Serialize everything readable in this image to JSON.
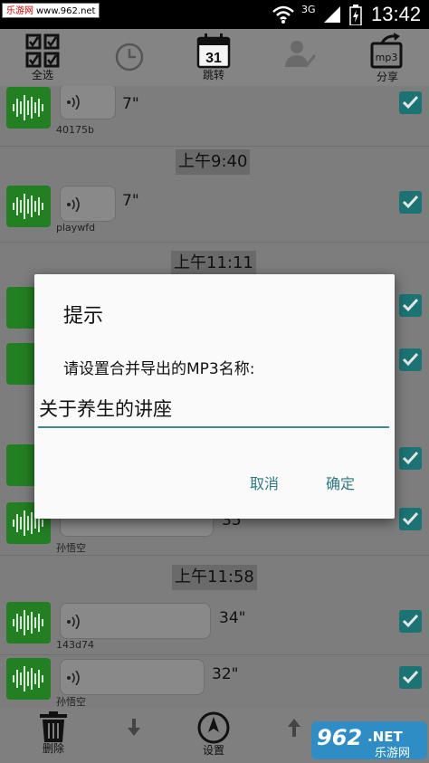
{
  "status_bar": {
    "watermark_site": "乐游网",
    "watermark_url": "www.962.net",
    "network": "3G",
    "time": "13:42",
    "icons": [
      "wifi-icon",
      "signal-icon",
      "battery-icon"
    ]
  },
  "toolbar": {
    "select_all_label": "全选",
    "jump_label": "跳转",
    "jump_day": "31",
    "share_label": "分享",
    "share_badge": "mp3"
  },
  "messages": [
    {
      "duration": "7\"",
      "name": "40175b"
    },
    {
      "duration": "7\"",
      "name": "playwfd"
    },
    {
      "duration": "35\"",
      "name": "孙悟空"
    },
    {
      "duration": "34\"",
      "name": "143d74"
    },
    {
      "duration": "32\"",
      "name": "孙悟空"
    }
  ],
  "time_labels": [
    "上午9:40",
    "上午11:11",
    "上午11:58"
  ],
  "dialog": {
    "title": "提示",
    "message": "请设置合并导出的MP3名称:",
    "input_value": "关于养生的讲座",
    "cancel_label": "取消",
    "confirm_label": "确定"
  },
  "bottom_bar": {
    "delete_label": "删除",
    "settings_label": "设置"
  },
  "logo": {
    "text": "962",
    "net": ".NET",
    "sub": "乐游网"
  },
  "colors": {
    "accent": "#3a8d89",
    "checkbox": "#1b7373",
    "voice_green": "#227f22"
  }
}
